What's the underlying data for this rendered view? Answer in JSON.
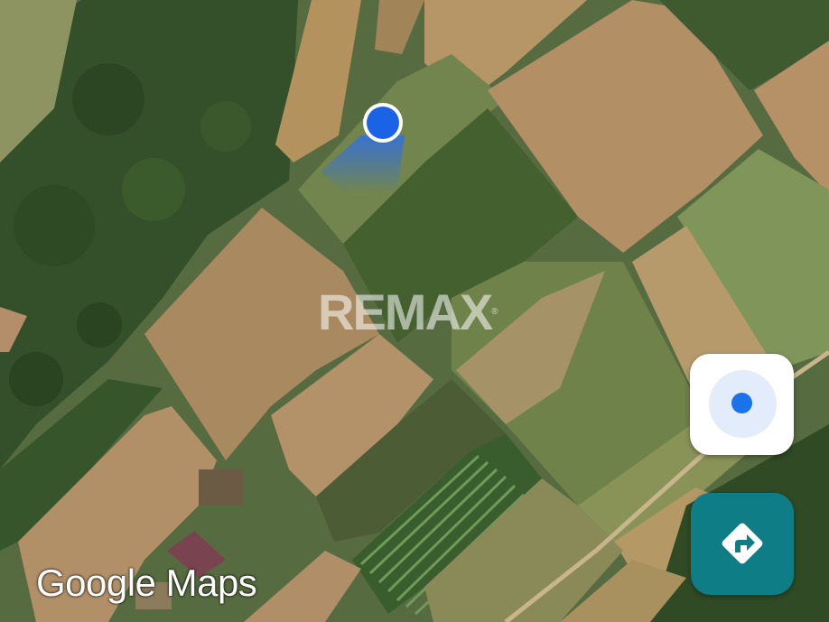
{
  "map": {
    "view": "satellite",
    "watermark": {
      "text": "REMAX",
      "mark": "®"
    },
    "branding": {
      "text": "Google Maps"
    },
    "location_marker": {
      "color": "#1a73e8",
      "icon": "blue-dot-with-heading-beam"
    }
  },
  "controls": {
    "my_location": {
      "icon": "my-location-icon",
      "color": "#1a73e8"
    },
    "directions": {
      "icon": "directions-arrow-icon",
      "color": "#0f7d86"
    }
  }
}
